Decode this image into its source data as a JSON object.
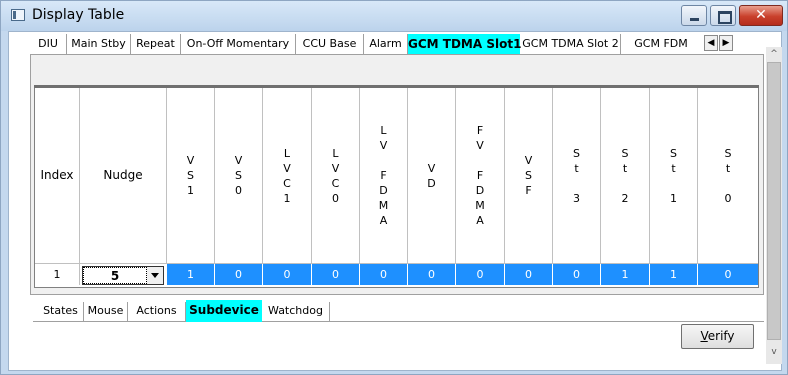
{
  "window": {
    "title": "Display Table",
    "close_glyph": "✕"
  },
  "top_tabs": [
    "DIU",
    "Main Stby",
    "Repeat",
    "On-Off Momentary",
    "CCU Base",
    "Alarm",
    "GCM TDMA Slot1",
    "GCM TDMA Slot 2",
    "GCM FDM"
  ],
  "selected_top_tab": "GCM TDMA Slot1",
  "tab_scroll": {
    "left": "◀",
    "right": "▶"
  },
  "table": {
    "headers": [
      "Index",
      "Nudge",
      "V\nS\n1",
      "V\nS\n0",
      "L\nV\nC\n1",
      "L\nV\nC\n0",
      "L\nV\n\nF\nD\nM\nA",
      "V\nD",
      "F\nV\n\nF\nD\nM\nA",
      "V\nS\nF",
      "S\nt\n\n3",
      "S\nt\n\n2",
      "S\nt\n\n1",
      "S\nt\n\n0"
    ],
    "row": {
      "index": "1",
      "nudge": "5",
      "values": [
        "1",
        "0",
        "0",
        "0",
        "0",
        "0",
        "0",
        "0",
        "0",
        "1",
        "1",
        "0"
      ]
    }
  },
  "bottom_tabs": [
    "States",
    "Mouse",
    "Actions",
    "Subdevice",
    "Watchdog"
  ],
  "selected_bottom_tab": "Subdevice",
  "verify_button": {
    "prefix": "",
    "underlined": "V",
    "rest": "erify"
  },
  "colors": {
    "selected_tab": "#00ffff",
    "row_highlight": "#1e90ff",
    "titlebar": "#c4d8ee",
    "close_button": "#c9402c"
  },
  "scrollbar": {
    "up": "^",
    "down": "v"
  }
}
